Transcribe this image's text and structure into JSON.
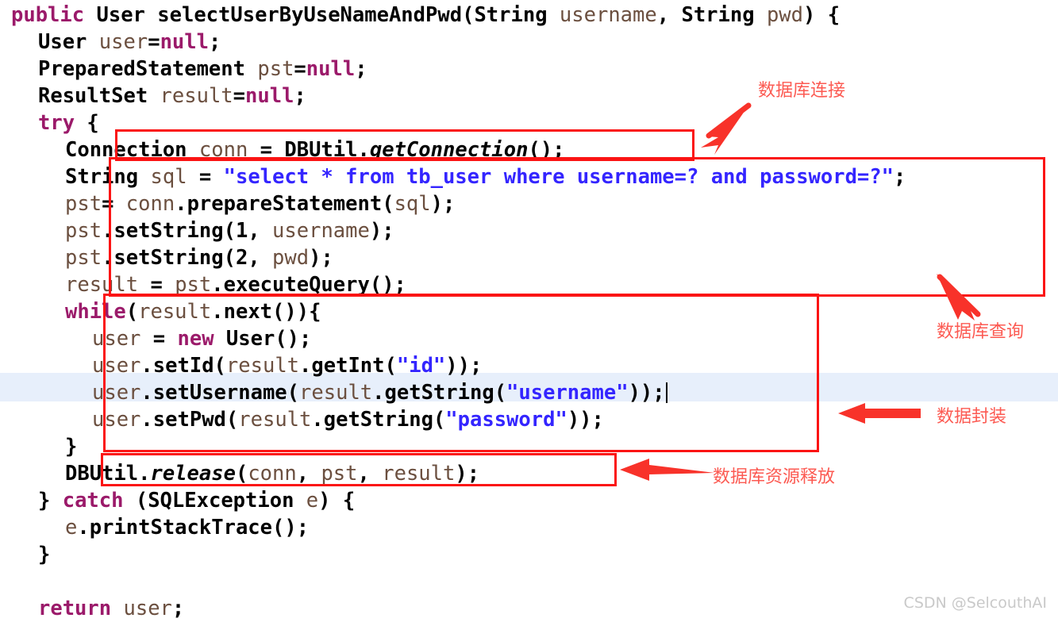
{
  "editor": {
    "language": "java",
    "current_line_index": 12,
    "caret_visible": true,
    "highlight_color": "#e7effb",
    "background_color": "#ffffff",
    "lines": [
      {
        "indent": 0,
        "text": "public User selectUserByUseNameAndPwd(String username, String pwd) {"
      },
      {
        "indent": 1,
        "text": "User user=null;"
      },
      {
        "indent": 1,
        "text": "PreparedStatement pst=null;"
      },
      {
        "indent": 1,
        "text": "ResultSet result=null;"
      },
      {
        "indent": 1,
        "text": "try {"
      },
      {
        "indent": 2,
        "text": "Connection conn = DBUtil.getConnection();"
      },
      {
        "indent": 2,
        "text": "String sql = \"select * from tb_user where username=? and password=?\";"
      },
      {
        "indent": 2,
        "text": "pst= conn.prepareStatement(sql);"
      },
      {
        "indent": 2,
        "text": "pst.setString(1, username);"
      },
      {
        "indent": 2,
        "text": "pst.setString(2, pwd);"
      },
      {
        "indent": 2,
        "text": "result = pst.executeQuery();"
      },
      {
        "indent": 2,
        "text": "while(result.next()){"
      },
      {
        "indent": 3,
        "text": "user = new User();"
      },
      {
        "indent": 3,
        "text": "user.setId(result.getInt(\"id\"));"
      },
      {
        "indent": 3,
        "text": "user.setUsername(result.getString(\"username\"));"
      },
      {
        "indent": 3,
        "text": "user.setPwd(result.getString(\"password\"));"
      },
      {
        "indent": 2,
        "text": "}"
      },
      {
        "indent": 2,
        "text": "DBUtil.release(conn, pst, result);"
      },
      {
        "indent": 1,
        "text": "} catch (SQLException e) {"
      },
      {
        "indent": 2,
        "text": "e.printStackTrace();"
      },
      {
        "indent": 1,
        "text": "}"
      },
      {
        "indent": 0,
        "text": ""
      },
      {
        "indent": 1,
        "text": "return user;"
      }
    ]
  },
  "annotations": {
    "color": "#fb1414",
    "label_color": "#fc5a52",
    "items": [
      {
        "id": "db-connection",
        "label": "数据库连接",
        "target_code": "Connection conn = DBUtil.getConnection();"
      },
      {
        "id": "db-query",
        "label": "数据库查询",
        "target_code": "String sql ... result = pst.executeQuery();"
      },
      {
        "id": "data-encapsulation",
        "label": "数据封装",
        "target_code": "while(result.next()){ ... }"
      },
      {
        "id": "db-resource-release",
        "label": "数据库资源释放",
        "target_code": "DBUtil.release(conn, pst, result);"
      }
    ]
  },
  "watermark": {
    "text": "CSDN @SelcouthAI"
  },
  "code_tokens": {
    "line0": [
      {
        "t": "public",
        "c": "kw"
      },
      {
        "t": " ",
        "c": "plain"
      },
      {
        "t": "User",
        "c": "typ"
      },
      {
        "t": " ",
        "c": "plain"
      },
      {
        "t": "selectUserByUseNameAndPwd",
        "c": "typ"
      },
      {
        "t": "(",
        "c": "punc"
      },
      {
        "t": "String",
        "c": "typ"
      },
      {
        "t": " ",
        "c": "plain"
      },
      {
        "t": "username",
        "c": "id"
      },
      {
        "t": ", ",
        "c": "punc"
      },
      {
        "t": "String",
        "c": "typ"
      },
      {
        "t": " ",
        "c": "plain"
      },
      {
        "t": "pwd",
        "c": "id"
      },
      {
        "t": ") {",
        "c": "punc"
      }
    ],
    "line1": [
      {
        "t": "User",
        "c": "typ"
      },
      {
        "t": " ",
        "c": "plain"
      },
      {
        "t": "user",
        "c": "id"
      },
      {
        "t": "=",
        "c": "punc"
      },
      {
        "t": "null",
        "c": "kw"
      },
      {
        "t": ";",
        "c": "punc"
      }
    ],
    "line2": [
      {
        "t": "PreparedStatement",
        "c": "typ"
      },
      {
        "t": " ",
        "c": "plain"
      },
      {
        "t": "pst",
        "c": "id"
      },
      {
        "t": "=",
        "c": "punc"
      },
      {
        "t": "null",
        "c": "kw"
      },
      {
        "t": ";",
        "c": "punc"
      }
    ],
    "line3": [
      {
        "t": "ResultSet",
        "c": "typ"
      },
      {
        "t": " ",
        "c": "plain"
      },
      {
        "t": "result",
        "c": "id"
      },
      {
        "t": "=",
        "c": "punc"
      },
      {
        "t": "null",
        "c": "kw"
      },
      {
        "t": ";",
        "c": "punc"
      }
    ],
    "line4": [
      {
        "t": "try",
        "c": "kw"
      },
      {
        "t": " {",
        "c": "punc"
      }
    ],
    "line5": [
      {
        "t": "Connection",
        "c": "typ"
      },
      {
        "t": " ",
        "c": "plain"
      },
      {
        "t": "conn",
        "c": "id"
      },
      {
        "t": " = ",
        "c": "punc"
      },
      {
        "t": "DBUtil",
        "c": "typ"
      },
      {
        "t": ".",
        "c": "punc"
      },
      {
        "t": "getConnection",
        "c": "sttc"
      },
      {
        "t": "();",
        "c": "punc"
      }
    ],
    "line6": [
      {
        "t": "String",
        "c": "typ"
      },
      {
        "t": " ",
        "c": "plain"
      },
      {
        "t": "sql",
        "c": "id"
      },
      {
        "t": " = ",
        "c": "punc"
      },
      {
        "t": "\"select * from tb_user where username=? and password=?\"",
        "c": "str"
      },
      {
        "t": ";",
        "c": "punc"
      }
    ],
    "line7": [
      {
        "t": "pst",
        "c": "id"
      },
      {
        "t": "= ",
        "c": "punc"
      },
      {
        "t": "conn",
        "c": "id"
      },
      {
        "t": ".",
        "c": "punc"
      },
      {
        "t": "prepareStatement",
        "c": "mth"
      },
      {
        "t": "(",
        "c": "punc"
      },
      {
        "t": "sql",
        "c": "id"
      },
      {
        "t": ");",
        "c": "punc"
      }
    ],
    "line8": [
      {
        "t": "pst",
        "c": "id"
      },
      {
        "t": ".",
        "c": "punc"
      },
      {
        "t": "setString",
        "c": "mth"
      },
      {
        "t": "(",
        "c": "punc"
      },
      {
        "t": "1",
        "c": "num"
      },
      {
        "t": ", ",
        "c": "punc"
      },
      {
        "t": "username",
        "c": "id"
      },
      {
        "t": ");",
        "c": "punc"
      }
    ],
    "line9": [
      {
        "t": "pst",
        "c": "id"
      },
      {
        "t": ".",
        "c": "punc"
      },
      {
        "t": "setString",
        "c": "mth"
      },
      {
        "t": "(",
        "c": "punc"
      },
      {
        "t": "2",
        "c": "num"
      },
      {
        "t": ", ",
        "c": "punc"
      },
      {
        "t": "pwd",
        "c": "id"
      },
      {
        "t": ");",
        "c": "punc"
      }
    ],
    "line10": [
      {
        "t": "result",
        "c": "id"
      },
      {
        "t": " = ",
        "c": "punc"
      },
      {
        "t": "pst",
        "c": "id"
      },
      {
        "t": ".",
        "c": "punc"
      },
      {
        "t": "executeQuery",
        "c": "mth"
      },
      {
        "t": "();",
        "c": "punc"
      }
    ],
    "line11": [
      {
        "t": "while",
        "c": "kw"
      },
      {
        "t": "(",
        "c": "punc"
      },
      {
        "t": "result",
        "c": "id"
      },
      {
        "t": ".",
        "c": "punc"
      },
      {
        "t": "next",
        "c": "mth"
      },
      {
        "t": "()){",
        "c": "punc"
      }
    ],
    "line12": [
      {
        "t": "user",
        "c": "id"
      },
      {
        "t": " = ",
        "c": "punc"
      },
      {
        "t": "new",
        "c": "kw"
      },
      {
        "t": " ",
        "c": "plain"
      },
      {
        "t": "User",
        "c": "typ"
      },
      {
        "t": "();",
        "c": "punc"
      }
    ],
    "line13": [
      {
        "t": "user",
        "c": "id"
      },
      {
        "t": ".",
        "c": "punc"
      },
      {
        "t": "setId",
        "c": "mth"
      },
      {
        "t": "(",
        "c": "punc"
      },
      {
        "t": "result",
        "c": "id"
      },
      {
        "t": ".",
        "c": "punc"
      },
      {
        "t": "getInt",
        "c": "mth"
      },
      {
        "t": "(",
        "c": "punc"
      },
      {
        "t": "\"id\"",
        "c": "str"
      },
      {
        "t": "));",
        "c": "punc"
      }
    ],
    "line14": [
      {
        "t": "user",
        "c": "id"
      },
      {
        "t": ".",
        "c": "punc"
      },
      {
        "t": "setUsername",
        "c": "mth"
      },
      {
        "t": "(",
        "c": "punc"
      },
      {
        "t": "result",
        "c": "id"
      },
      {
        "t": ".",
        "c": "punc"
      },
      {
        "t": "getString",
        "c": "mth"
      },
      {
        "t": "(",
        "c": "punc"
      },
      {
        "t": "\"username\"",
        "c": "str"
      },
      {
        "t": "));",
        "c": "punc"
      }
    ],
    "line15": [
      {
        "t": "user",
        "c": "id"
      },
      {
        "t": ".",
        "c": "punc"
      },
      {
        "t": "setPwd",
        "c": "mth"
      },
      {
        "t": "(",
        "c": "punc"
      },
      {
        "t": "result",
        "c": "id"
      },
      {
        "t": ".",
        "c": "punc"
      },
      {
        "t": "getString",
        "c": "mth"
      },
      {
        "t": "(",
        "c": "punc"
      },
      {
        "t": "\"password\"",
        "c": "str"
      },
      {
        "t": "));",
        "c": "punc"
      }
    ],
    "line16": [
      {
        "t": "}",
        "c": "punc"
      }
    ],
    "line17": [
      {
        "t": "DBUtil",
        "c": "typ"
      },
      {
        "t": ".",
        "c": "punc"
      },
      {
        "t": "release",
        "c": "sttc"
      },
      {
        "t": "(",
        "c": "punc"
      },
      {
        "t": "conn",
        "c": "id"
      },
      {
        "t": ", ",
        "c": "punc"
      },
      {
        "t": "pst",
        "c": "id"
      },
      {
        "t": ", ",
        "c": "punc"
      },
      {
        "t": "result",
        "c": "id"
      },
      {
        "t": ");",
        "c": "punc"
      }
    ],
    "line18": [
      {
        "t": "} ",
        "c": "punc"
      },
      {
        "t": "catch",
        "c": "kw"
      },
      {
        "t": " (",
        "c": "punc"
      },
      {
        "t": "SQLException",
        "c": "typ"
      },
      {
        "t": " ",
        "c": "plain"
      },
      {
        "t": "e",
        "c": "id"
      },
      {
        "t": ") {",
        "c": "punc"
      }
    ],
    "line19": [
      {
        "t": "e",
        "c": "id"
      },
      {
        "t": ".",
        "c": "punc"
      },
      {
        "t": "printStackTrace",
        "c": "mth"
      },
      {
        "t": "();",
        "c": "punc"
      }
    ],
    "line20": [
      {
        "t": "}",
        "c": "punc"
      }
    ],
    "line21": [],
    "line22": [
      {
        "t": "return",
        "c": "kw"
      },
      {
        "t": " ",
        "c": "plain"
      },
      {
        "t": "user",
        "c": "id"
      },
      {
        "t": ";",
        "c": "punc"
      }
    ]
  }
}
